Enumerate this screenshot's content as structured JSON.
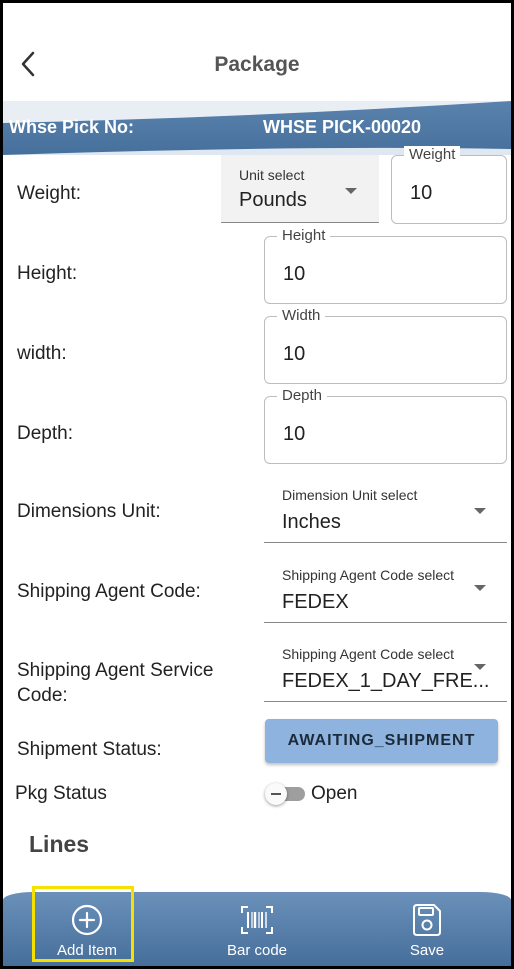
{
  "header": {
    "title": "Package"
  },
  "pick": {
    "label": "Whse Pick No:",
    "value": "WHSE PICK-00020"
  },
  "weight": {
    "label": "Weight:",
    "unit_select_label": "Unit select",
    "unit_select_value": "Pounds",
    "field_label": "Weight",
    "field_value": "10"
  },
  "height": {
    "label": "Height:",
    "field_label": "Height",
    "field_value": "10"
  },
  "width": {
    "label": "width:",
    "field_label": "Width",
    "field_value": "10"
  },
  "depth": {
    "label": "Depth:",
    "field_label": "Depth",
    "field_value": "10"
  },
  "dimensions_unit": {
    "label": "Dimensions Unit:",
    "select_label": "Dimension Unit select",
    "select_value": "Inches"
  },
  "shipping_agent": {
    "label": "Shipping Agent Code:",
    "select_label": "Shipping Agent Code select",
    "select_value": "FEDEX"
  },
  "shipping_service": {
    "label_line1": "Shipping Agent Service",
    "label_line2": "Code:",
    "select_label": "Shipping Agent Code select",
    "select_value": "FEDEX_1_DAY_FRE..."
  },
  "shipment_status": {
    "label": "Shipment Status:",
    "button": "AWAITING_SHIPMENT"
  },
  "pkg_status": {
    "label": "Pkg Status",
    "toggle_text": "Open"
  },
  "lines": {
    "title": "Lines"
  },
  "bottom_nav": {
    "add_item": "Add Item",
    "bar_code": "Bar code",
    "save": "Save"
  },
  "colors": {
    "accent": "#4f78a4",
    "status_button": "#8eb3de",
    "highlight": "#f5e000"
  }
}
